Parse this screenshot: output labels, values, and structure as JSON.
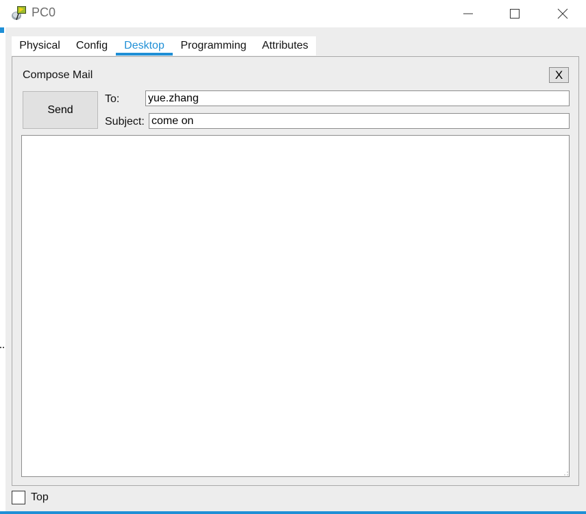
{
  "window": {
    "title": "PC0",
    "icon": "pc-device-icon",
    "controls": [
      "minimize-icon",
      "maximize-icon",
      "close-icon"
    ]
  },
  "tabs": [
    {
      "label": "Physical",
      "active": false
    },
    {
      "label": "Config",
      "active": false
    },
    {
      "label": "Desktop",
      "active": true
    },
    {
      "label": "Programming",
      "active": false
    },
    {
      "label": "Attributes",
      "active": false
    }
  ],
  "compose": {
    "title": "Compose Mail",
    "close_label": "X",
    "send_label": "Send",
    "to_label": "To:",
    "to_value": "yue.zhang",
    "subject_label": "Subject:",
    "subject_value": "come on",
    "body_value": ""
  },
  "footer": {
    "top_label": "Top",
    "top_checked": false
  },
  "colors": {
    "accent": "#1f8fd6",
    "panel_bg": "#ededed",
    "button_bg": "#e1e1e1"
  }
}
